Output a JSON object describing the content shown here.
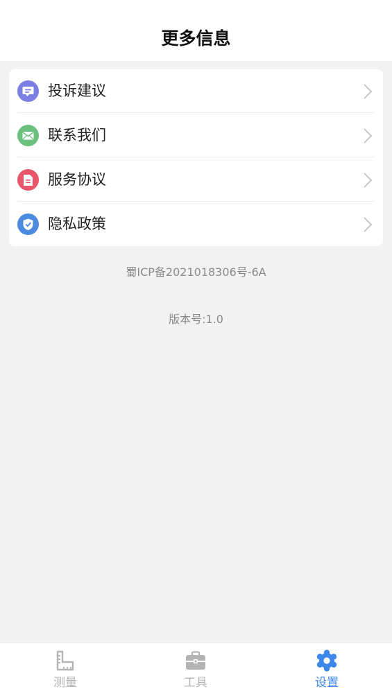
{
  "header": {
    "title": "更多信息"
  },
  "menu": {
    "items": [
      {
        "label": "投诉建议",
        "icon": "feedback-icon",
        "color": "#7b7fe3"
      },
      {
        "label": "联系我们",
        "icon": "mail-icon",
        "color": "#6cc07e"
      },
      {
        "label": "服务协议",
        "icon": "document-icon",
        "color": "#e8566a"
      },
      {
        "label": "隐私政策",
        "icon": "shield-icon",
        "color": "#4a8be0"
      }
    ]
  },
  "footer": {
    "icp": "蜀ICP备2021018306号-6A",
    "version": "版本号:1.0"
  },
  "tabbar": {
    "tabs": [
      {
        "label": "测量",
        "icon": "ruler-icon",
        "active": false
      },
      {
        "label": "工具",
        "icon": "toolbox-icon",
        "active": false
      },
      {
        "label": "设置",
        "icon": "gear-icon",
        "active": true
      }
    ],
    "active_color": "#3e87ea",
    "inactive_color": "#b4b4b4"
  }
}
